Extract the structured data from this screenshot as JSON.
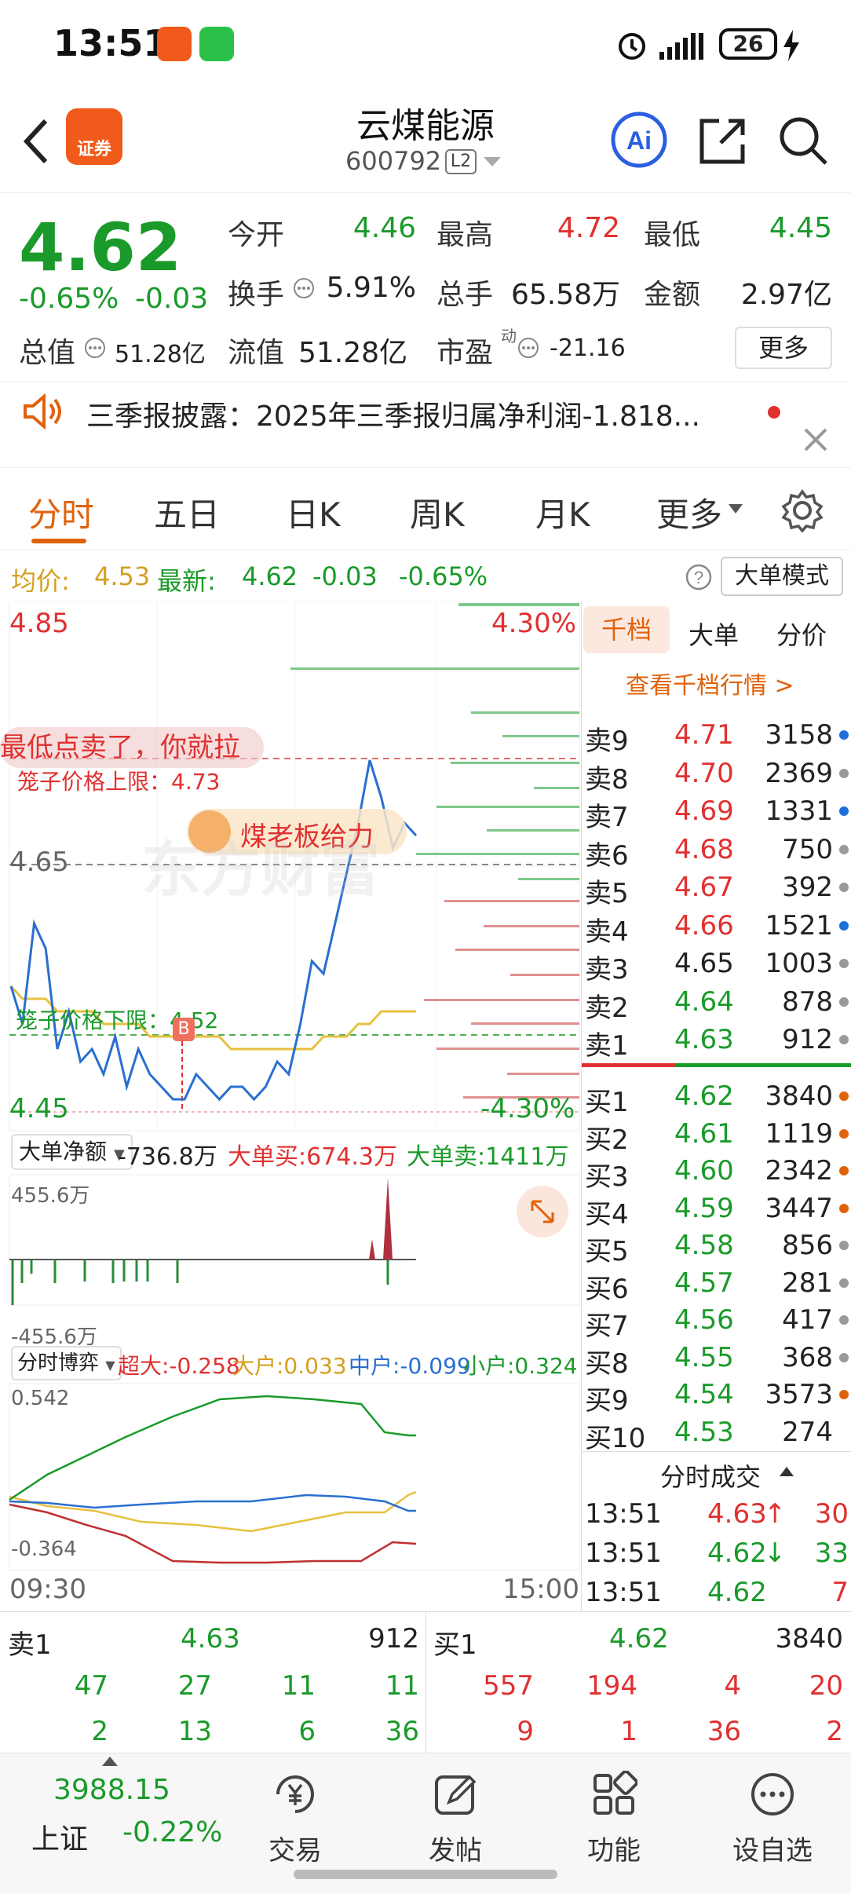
{
  "status_bar": {
    "time": "13:51",
    "battery": "26"
  },
  "header": {
    "title": "云煤能源",
    "code": "600792",
    "level": "L2"
  },
  "quote": {
    "price": "4.62",
    "change_pct": "-0.65%",
    "change": "-0.03",
    "open_label": "今开",
    "open": "4.46",
    "high_label": "最高",
    "high": "4.72",
    "low_label": "最低",
    "low": "4.45",
    "turnover_label": "换手",
    "turnover": "5.91%",
    "volume_label": "总手",
    "volume": "65.58万",
    "amount_label": "金额",
    "amount": "2.97亿",
    "mktcap_label": "总值",
    "mktcap": "51.28亿",
    "float_label": "流值",
    "float_cap": "51.28亿",
    "pe_label": "市盈",
    "pe_sup": "动",
    "pe": "-21.16",
    "more_label": "更多"
  },
  "notice": {
    "text": "三季报披露：2025年三季报归属净利润-1.818..."
  },
  "tabs": [
    {
      "label": "分时"
    },
    {
      "label": "五日"
    },
    {
      "label": "日K"
    },
    {
      "label": "周K"
    },
    {
      "label": "月K"
    },
    {
      "label": "更多"
    }
  ],
  "info_line": {
    "avg_label": "均价:",
    "avg": "4.53",
    "latest_label": "最新:",
    "latest": "4.62",
    "latest_change": "-0.03",
    "latest_pct": "-0.65%",
    "mode_label": "大单模式"
  },
  "chart": {
    "price_high": "4.85",
    "price_mid": "4.65",
    "price_low": "4.45",
    "pct_high": "4.30%",
    "pct_low": "-4.30%",
    "upper_limit_label": "笼子价格上限：4.73",
    "lower_limit_label": "笼子价格下限：4.52",
    "danmu": "最低点卖了，你就拉",
    "promo": "煤老板给力",
    "watermark": "东方财富",
    "b_marker": "B",
    "time_start": "09:30",
    "time_end": "15:00"
  },
  "chart_data": {
    "type": "line",
    "title": "",
    "ylim": [
      4.45,
      4.85
    ],
    "series": [
      {
        "values": [
          4.55,
          4.52,
          4.6,
          4.58,
          4.5,
          4.53,
          4.49,
          4.5,
          4.48,
          4.51,
          4.47,
          4.5,
          4.48,
          4.47,
          4.46,
          4.46,
          4.48,
          4.47,
          4.46,
          4.47,
          4.47,
          4.46,
          4.47,
          4.49,
          4.48,
          4.52,
          4.57,
          4.56,
          4.6,
          4.64,
          4.68,
          4.73,
          4.7,
          4.66,
          4.68,
          4.67
        ]
      },
      {
        "values": [
          4.55,
          4.54,
          4.54,
          4.54,
          4.53,
          4.53,
          4.53,
          4.53,
          4.52,
          4.52,
          4.52,
          4.52,
          4.51,
          4.51,
          4.51,
          4.51,
          4.51,
          4.51,
          4.51,
          4.5,
          4.5,
          4.5,
          4.5,
          4.5,
          4.5,
          4.5,
          4.5,
          4.51,
          4.51,
          4.51,
          4.52,
          4.52,
          4.53,
          4.53,
          4.53,
          4.53
        ]
      }
    ]
  },
  "big_order": {
    "selector": "大单净额",
    "net": "-736.8万",
    "buy": "大单买:674.3万",
    "sell": "大单卖:1411万",
    "top": "455.6万",
    "bottom": "-455.6万"
  },
  "game": {
    "selector": "分时博弈",
    "super": "超大:-0.258",
    "large": "大户:0.033",
    "mid": "中户:-0.099",
    "small": "小户:0.324",
    "top": "0.542",
    "bottom": "-0.364"
  },
  "book": {
    "tabs": [
      "千档",
      "大单",
      "分价"
    ],
    "link": "查看千档行情 >",
    "asks": [
      {
        "label": "卖9",
        "price": "4.71",
        "vol": "3158",
        "dot": "#1e6fd9"
      },
      {
        "label": "卖8",
        "price": "4.70",
        "vol": "2369",
        "dot": "#999999"
      },
      {
        "label": "卖7",
        "price": "4.69",
        "vol": "1331",
        "dot": "#1e6fd9"
      },
      {
        "label": "卖6",
        "price": "4.68",
        "vol": "750",
        "dot": "#999999"
      },
      {
        "label": "卖5",
        "price": "4.67",
        "vol": "392",
        "dot": "#999999"
      },
      {
        "label": "卖4",
        "price": "4.66",
        "vol": "1521",
        "dot": "#1e6fd9"
      },
      {
        "label": "卖3",
        "price": "4.65",
        "vol": "1003",
        "dot": "#999999"
      },
      {
        "label": "卖2",
        "price": "4.64",
        "vol": "878",
        "dot": "#999999"
      },
      {
        "label": "卖1",
        "price": "4.63",
        "vol": "912",
        "dot": "#999999"
      }
    ],
    "bids": [
      {
        "label": "买1",
        "price": "4.62",
        "vol": "3840",
        "dot": "#e0620a"
      },
      {
        "label": "买2",
        "price": "4.61",
        "vol": "1119",
        "dot": "#e0620a"
      },
      {
        "label": "买3",
        "price": "4.60",
        "vol": "2342",
        "dot": "#e0620a"
      },
      {
        "label": "买4",
        "price": "4.59",
        "vol": "3447",
        "dot": "#e0620a"
      },
      {
        "label": "买5",
        "price": "4.58",
        "vol": "856",
        "dot": "#999999"
      },
      {
        "label": "买6",
        "price": "4.57",
        "vol": "281",
        "dot": "#999999"
      },
      {
        "label": "买7",
        "price": "4.56",
        "vol": "417",
        "dot": "#999999"
      },
      {
        "label": "买8",
        "price": "4.55",
        "vol": "368",
        "dot": "#999999"
      },
      {
        "label": "买9",
        "price": "4.54",
        "vol": "3573",
        "dot": "#e0620a"
      },
      {
        "label": "买10",
        "price": "4.53",
        "vol": "274",
        "dot": ""
      }
    ],
    "trades_title": "分时成交",
    "trades": [
      {
        "time": "13:51",
        "price": "4.63",
        "arrow": "↑",
        "vol": "30"
      },
      {
        "time": "13:51",
        "price": "4.62",
        "arrow": "↓",
        "vol": "33"
      },
      {
        "time": "13:51",
        "price": "4.62",
        "arrow": "",
        "vol": "7"
      }
    ]
  },
  "bottom_rows": {
    "sell_label": "卖1",
    "sell_price": "4.63",
    "sell_vol": "912",
    "buy_label": "买1",
    "buy_price": "4.62",
    "buy_vol": "3840",
    "sell_row1": [
      "47",
      "27",
      "11",
      "11"
    ],
    "sell_row2": [
      "2",
      "13",
      "6",
      "36"
    ],
    "buy_row1": [
      "557",
      "194",
      "4",
      "20"
    ],
    "buy_row2": [
      "9",
      "1",
      "36",
      "2"
    ]
  },
  "nav": {
    "index_value": "3988.15",
    "index_name": "上证",
    "index_change": "-0.22%",
    "items": [
      {
        "label": "交易",
        "icon": "trade-icon"
      },
      {
        "label": "发帖",
        "icon": "post-icon"
      },
      {
        "label": "功能",
        "icon": "function-icon"
      },
      {
        "label": "设自选",
        "icon": "add-watchlist-icon"
      }
    ]
  }
}
